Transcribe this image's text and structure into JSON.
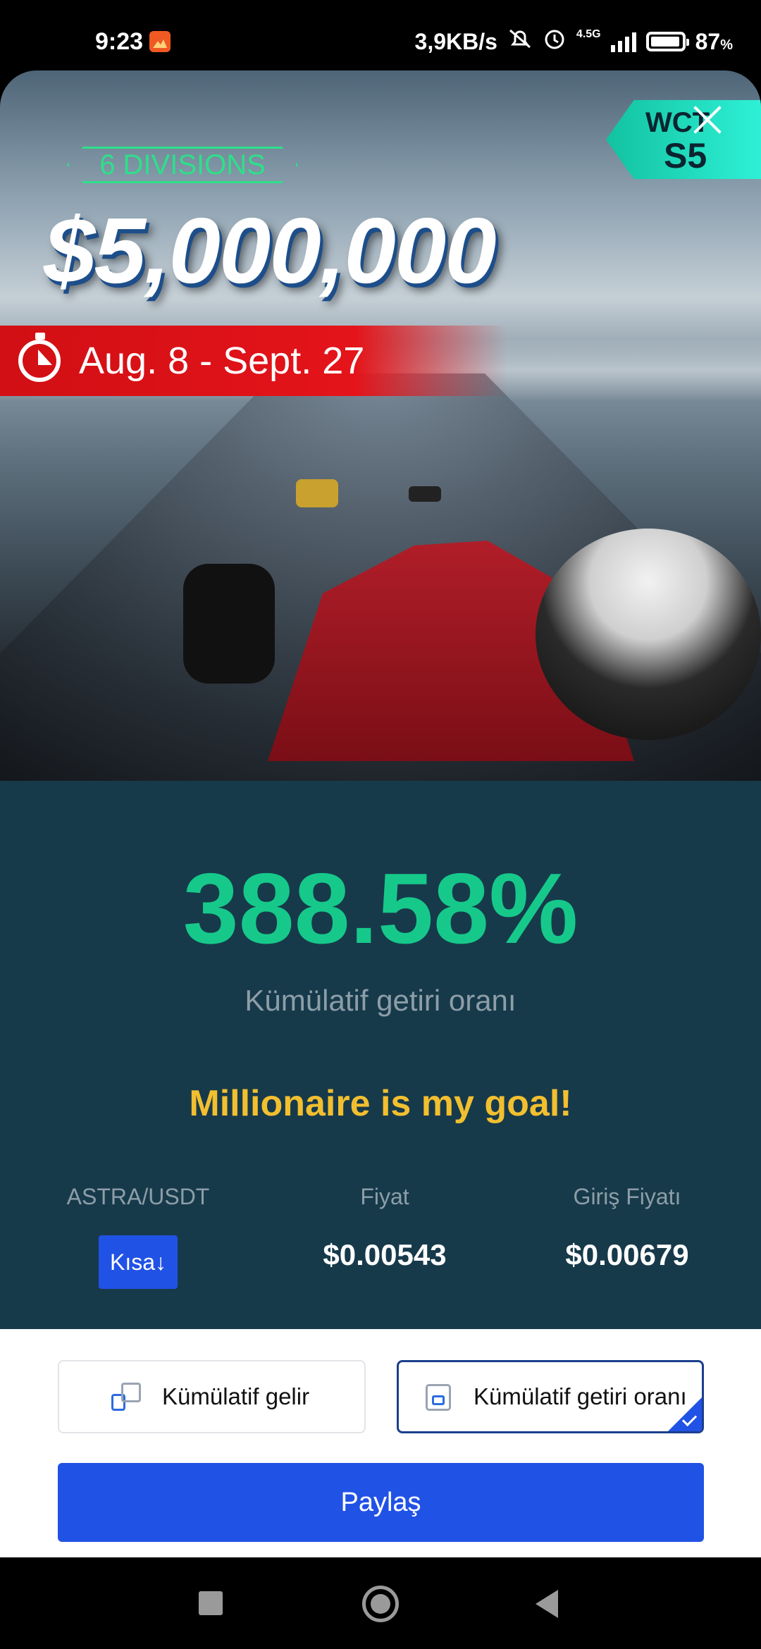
{
  "status_bar": {
    "time": "9:23",
    "network_speed": "3,9KB/s",
    "signal_label": "4.5G",
    "battery": "87",
    "battery_unit": "%"
  },
  "banner": {
    "divisions": "6 DIVISIONS",
    "prize": "$5,000,000",
    "dates": "Aug. 8 - Sept. 27",
    "badge_top": "WCT",
    "badge_bottom": "S5"
  },
  "stats": {
    "return_value": "388.58%",
    "return_label": "Kümülatif getiri oranı",
    "motto": "Millionaire is my goal!",
    "pair_label": "ASTRA/USDT",
    "direction_button": "Kısa↓",
    "price_label": "Fiyat",
    "price_value": "$0.00543",
    "entry_label": "Giriş Fiyatı",
    "entry_value": "$0.00679"
  },
  "options": {
    "cumulative_income": "Kümülatif gelir",
    "cumulative_return": "Kümülatif getiri oranı",
    "selected": "cumulative_return"
  },
  "share_button": "Paylaş",
  "colors": {
    "accent_green": "#16c98a",
    "motto_yellow": "#f2bf2f",
    "primary_blue": "#2152e6",
    "panel_bg": "#173a4b"
  },
  "icons": [
    "app-notification-icon",
    "mute-icon",
    "alarm-icon",
    "signal-icon",
    "battery-icon",
    "close-icon",
    "stopwatch-icon",
    "chart-icon",
    "calendar-icon",
    "check-icon",
    "nav-recents-icon",
    "nav-home-icon",
    "nav-back-icon"
  ]
}
